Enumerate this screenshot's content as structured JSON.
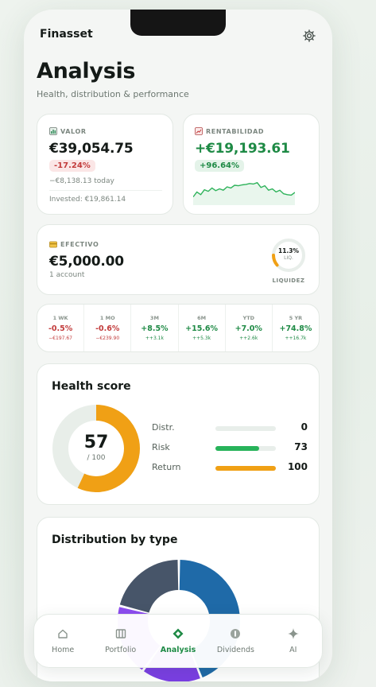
{
  "app": {
    "brand": "Finasset",
    "title": "Analysis",
    "subtitle": "Health, distribution & performance"
  },
  "valor": {
    "label": "VALOR",
    "value": "€39,054.75",
    "change_pct": "-17.24%",
    "change_abs": "−€8,138.13 today",
    "invested": "Invested: €19,861.14"
  },
  "rentabilidad": {
    "label": "RENTABILIDAD",
    "value": "+€19,193.61",
    "pct": "+96.64%",
    "sparkline": [
      0.3,
      0.52,
      0.4,
      0.62,
      0.55,
      0.7,
      0.58,
      0.66,
      0.6,
      0.75,
      0.7,
      0.82,
      0.8,
      0.84,
      0.86,
      0.9,
      0.88,
      0.94,
      0.72,
      0.8,
      0.6,
      0.66,
      0.52,
      0.6,
      0.44,
      0.4,
      0.38,
      0.5
    ]
  },
  "efectivo": {
    "label": "EFECTIVO",
    "value": "€5,000.00",
    "accounts": "1 account",
    "liq_pct": "11.3%",
    "liq_value": 0.113,
    "liq_short": "LIQ.",
    "liq_label": "LIQUIDEZ"
  },
  "periods": [
    {
      "label": "1 WK",
      "value": "-0.5%",
      "sub": "−€197.67",
      "dir": "neg"
    },
    {
      "label": "1 MO",
      "value": "-0.6%",
      "sub": "−€239.90",
      "dir": "neg"
    },
    {
      "label": "3M",
      "value": "+8.5%",
      "sub": "++3.1k",
      "dir": "pos"
    },
    {
      "label": "6M",
      "value": "+15.6%",
      "sub": "++5.3k",
      "dir": "pos"
    },
    {
      "label": "YTD",
      "value": "+7.0%",
      "sub": "++2.6k",
      "dir": "pos"
    },
    {
      "label": "5 YR",
      "value": "+74.8%",
      "sub": "++16.7k",
      "dir": "pos"
    }
  ],
  "health": {
    "title": "Health score",
    "score": "57",
    "score_value": 57,
    "score_max": "/ 100",
    "metrics": [
      {
        "label": "Distr.",
        "value": "0",
        "fill": 0,
        "color": "#e8eeea"
      },
      {
        "label": "Risk",
        "value": "73",
        "fill": 0.73,
        "color": "#27b35a"
      },
      {
        "label": "Return",
        "value": "100",
        "fill": 1.0,
        "color": "#f0a015"
      }
    ]
  },
  "distribution": {
    "title": "Distribution by type",
    "segments": [
      {
        "share": 0.44,
        "color": "#1f6aa8"
      },
      {
        "share": 0.16,
        "color": "#7b3fe4"
      },
      {
        "share": 0.19,
        "color": "#8d4cf0"
      },
      {
        "share": 0.21,
        "color": "#475569"
      }
    ]
  },
  "nav": [
    {
      "label": "Home",
      "icon": "home-icon",
      "active": false
    },
    {
      "label": "Portfolio",
      "icon": "portfolio-icon",
      "active": false
    },
    {
      "label": "Analysis",
      "icon": "analysis-icon",
      "active": true
    },
    {
      "label": "Dividends",
      "icon": "dividends-icon",
      "active": false
    },
    {
      "label": "AI",
      "icon": "ai-sparkle-icon",
      "active": false
    }
  ],
  "colors": {
    "accent": "#1e8a45",
    "negative": "#c23b3b",
    "orange": "#f0a015"
  }
}
